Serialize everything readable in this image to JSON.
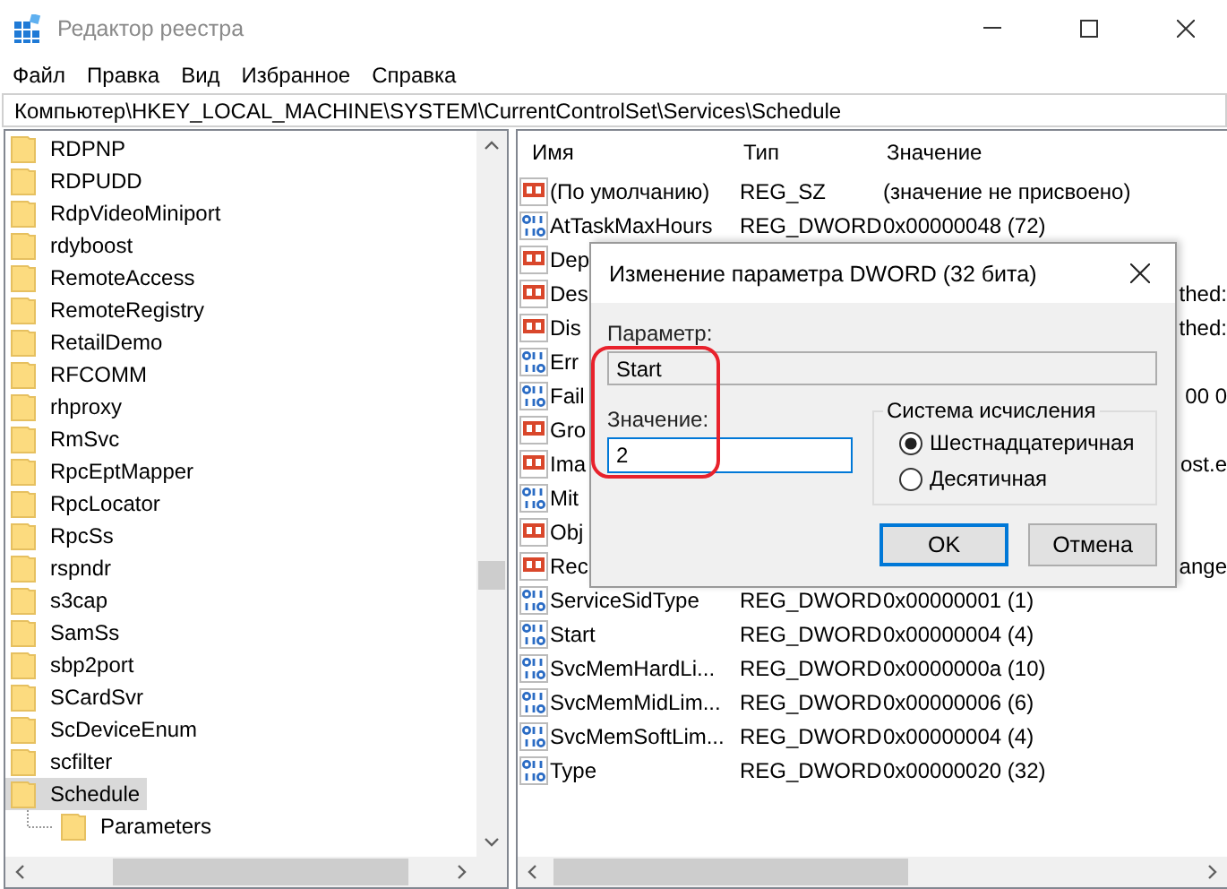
{
  "window": {
    "title": "Редактор реестра"
  },
  "menu": [
    "Файл",
    "Правка",
    "Вид",
    "Избранное",
    "Справка"
  ],
  "address": "Компьютер\\HKEY_LOCAL_MACHINE\\SYSTEM\\CurrentControlSet\\Services\\Schedule",
  "tree": {
    "items": [
      {
        "label": "RDPNP",
        "selected": false
      },
      {
        "label": "RDPUDD",
        "selected": false
      },
      {
        "label": "RdpVideoMiniport",
        "selected": false
      },
      {
        "label": "rdyboost",
        "selected": false
      },
      {
        "label": "RemoteAccess",
        "selected": false
      },
      {
        "label": "RemoteRegistry",
        "selected": false
      },
      {
        "label": "RetailDemo",
        "selected": false
      },
      {
        "label": "RFCOMM",
        "selected": false
      },
      {
        "label": "rhproxy",
        "selected": false
      },
      {
        "label": "RmSvc",
        "selected": false
      },
      {
        "label": "RpcEptMapper",
        "selected": false
      },
      {
        "label": "RpcLocator",
        "selected": false
      },
      {
        "label": "RpcSs",
        "selected": false
      },
      {
        "label": "rspndr",
        "selected": false
      },
      {
        "label": "s3cap",
        "selected": false
      },
      {
        "label": "SamSs",
        "selected": false
      },
      {
        "label": "sbp2port",
        "selected": false
      },
      {
        "label": "SCardSvr",
        "selected": false
      },
      {
        "label": "ScDeviceEnum",
        "selected": false
      },
      {
        "label": "scfilter",
        "selected": false
      },
      {
        "label": "Schedule",
        "selected": true,
        "children": [
          {
            "label": "Parameters",
            "selected": false
          }
        ]
      }
    ]
  },
  "values": {
    "columns": [
      "Имя",
      "Тип",
      "Значение"
    ],
    "rows": [
      {
        "kind": "string",
        "name": "(По умолчанию)",
        "type": "REG_SZ",
        "value": "(значение не присвоено)"
      },
      {
        "kind": "dword",
        "name": "AtTaskMaxHours",
        "type": "REG_DWORD",
        "value": "0x00000048 (72)"
      },
      {
        "kind": "string",
        "name": "Dep"
      },
      {
        "kind": "string",
        "name": "Des",
        "value": "thed:"
      },
      {
        "kind": "string",
        "name": "Dis",
        "value": "thed:"
      },
      {
        "kind": "dword",
        "name": "Err"
      },
      {
        "kind": "dword",
        "name": "Fail",
        "value": "00 0"
      },
      {
        "kind": "string",
        "name": "Gro"
      },
      {
        "kind": "string",
        "name": "Ima",
        "value": "ost.e"
      },
      {
        "kind": "dword",
        "name": "Mit"
      },
      {
        "kind": "string",
        "name": "Obj"
      },
      {
        "kind": "string",
        "name": "Rec",
        "value": "ange"
      },
      {
        "kind": "dword",
        "name": "ServiceSidType",
        "type": "REG_DWORD",
        "value": "0x00000001 (1)"
      },
      {
        "kind": "dword",
        "name": "Start",
        "type": "REG_DWORD",
        "value": "0x00000004 (4)"
      },
      {
        "kind": "dword",
        "name": "SvcMemHardLi...",
        "type": "REG_DWORD",
        "value": "0x0000000a (10)"
      },
      {
        "kind": "dword",
        "name": "SvcMemMidLim...",
        "type": "REG_DWORD",
        "value": "0x00000006 (6)"
      },
      {
        "kind": "dword",
        "name": "SvcMemSoftLim...",
        "type": "REG_DWORD",
        "value": "0x00000004 (4)"
      },
      {
        "kind": "dword",
        "name": "Type",
        "type": "REG_DWORD",
        "value": "0x00000020 (32)"
      }
    ]
  },
  "dialog": {
    "title": "Изменение параметра DWORD (32 бита)",
    "param_label": "Параметр:",
    "param_value": "Start",
    "value_label": "Значение:",
    "value": "2",
    "radix_group": "Система исчисления",
    "radix_options": [
      {
        "label": "Шестнадцатеричная",
        "selected": true
      },
      {
        "label": "Десятичная",
        "selected": false
      }
    ],
    "buttons": [
      {
        "label": "OK",
        "default": true
      },
      {
        "label": "Отмена",
        "default": false
      }
    ]
  }
}
